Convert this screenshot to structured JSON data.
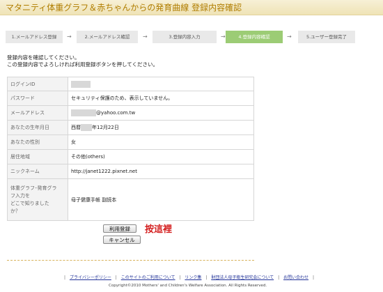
{
  "header": {
    "title": "マタニティ体重グラフ＆赤ちゃんからの発育曲線 登録内容確認"
  },
  "steps": [
    {
      "label": "1.メールアドレス登録"
    },
    {
      "label": "2.メールアドレス確認"
    },
    {
      "label": "3.登録内容入力"
    },
    {
      "label": "4.登録内容確認"
    },
    {
      "label": "5.ユーザー登録完了"
    }
  ],
  "step_arrow": "→",
  "intro": {
    "line1": "登録内容を確認してください。",
    "line2": "この登録内容でよろしければ利用登録ボタンを押してください。"
  },
  "form": {
    "login_id": {
      "label": "ログインID",
      "value": ""
    },
    "password": {
      "label": "パスワード",
      "value": "セキュリティ保護のため、表示していません。"
    },
    "email": {
      "label": "メールアドレス",
      "suffix": "@yahoo.com.tw"
    },
    "birth": {
      "label": "あなたの生年月日",
      "prefix": "西暦",
      "suffix": "年12月22日"
    },
    "gender": {
      "label": "あなたの性別",
      "value": "女"
    },
    "region": {
      "label": "居住地域",
      "value": "その他(others)"
    },
    "nickname": {
      "label": "ニックネーム",
      "value": "http://janet1222.pixnet.net"
    },
    "source": {
      "label_lines": [
        "体重グラフ･発育グラ",
        "フ入力を",
        "どこで知りました",
        "か？"
      ],
      "value": "母子健康手帳 副読本"
    }
  },
  "buttons": {
    "register": "利用登録",
    "cancel": "キャンセル"
  },
  "annotation": {
    "text": "按這裡",
    "color": "#d42020"
  },
  "footer": {
    "links": [
      "プライバシーポリシー",
      "このサイトのご利用について",
      "リンク集",
      "財団法人母子衛生研究会について",
      "お問い合わせ"
    ],
    "separator": "|",
    "copyright": "Copyright©2010 Mothers' and Children's Welfare Association. All Rights Reserved."
  },
  "colors": {
    "title": "#b07d00",
    "active_step": "#9ccc75",
    "link": "#223399"
  }
}
